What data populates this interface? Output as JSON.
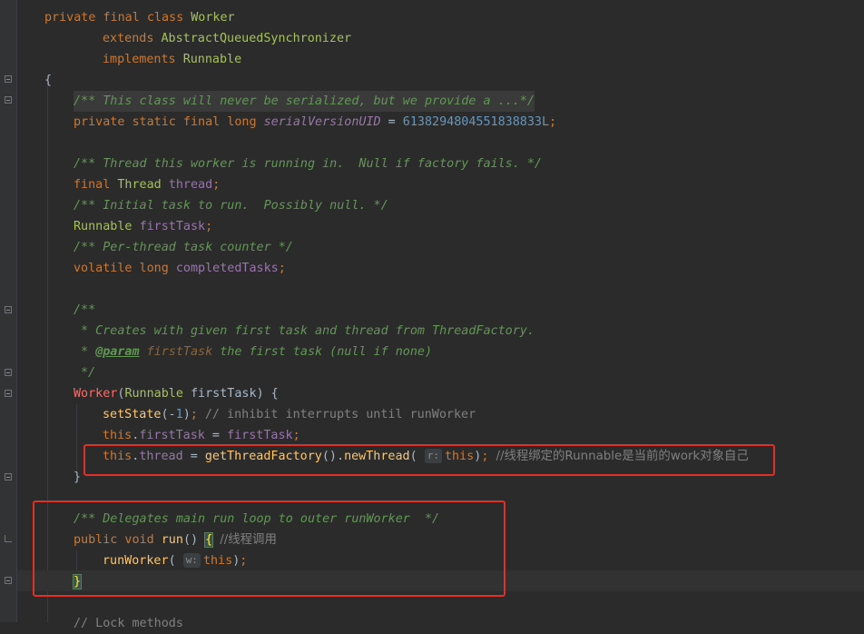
{
  "editor": {
    "language": "Java",
    "lines": [
      {
        "id": "l1",
        "tokens": [
          [
            "kw",
            "private final class "
          ],
          [
            "iface",
            "Worker"
          ]
        ]
      },
      {
        "id": "l2",
        "tokens": [
          [
            "kw",
            "extends "
          ],
          [
            "iface",
            "AbstractQueuedSynchronizer"
          ]
        ]
      },
      {
        "id": "l3",
        "tokens": [
          [
            "kw",
            "implements "
          ],
          [
            "iface",
            "Runnable"
          ]
        ]
      },
      {
        "id": "l4",
        "tokens": [
          [
            "cls",
            "{"
          ]
        ]
      },
      {
        "id": "l5",
        "tokens": [
          [
            "doc",
            "/** This class will never be serialized, but we provide a ...*/"
          ]
        ]
      },
      {
        "id": "l6",
        "tokens": [
          [
            "kw",
            "private static final long "
          ],
          [
            "sfld",
            "serialVersionUID"
          ],
          [
            "cls",
            " = "
          ],
          [
            "num",
            "6138294804551838833L"
          ],
          [
            "kw",
            ";"
          ]
        ]
      },
      {
        "id": "l7",
        "tokens": []
      },
      {
        "id": "l8",
        "tokens": [
          [
            "doc",
            "/** Thread this worker is running in.  Null if factory fails. */"
          ]
        ]
      },
      {
        "id": "l9",
        "tokens": [
          [
            "kw",
            "final "
          ],
          [
            "iface",
            "Thread "
          ],
          [
            "fld",
            "thread"
          ],
          [
            "kw",
            ";"
          ]
        ]
      },
      {
        "id": "l10",
        "tokens": [
          [
            "doc",
            "/** Initial task to run.  Possibly null. */"
          ]
        ]
      },
      {
        "id": "l11",
        "tokens": [
          [
            "iface",
            "Runnable "
          ],
          [
            "fld",
            "firstTask"
          ],
          [
            "kw",
            ";"
          ]
        ]
      },
      {
        "id": "l12",
        "tokens": [
          [
            "doc",
            "/** Per-thread task counter */"
          ]
        ]
      },
      {
        "id": "l13",
        "tokens": [
          [
            "kw",
            "volatile long "
          ],
          [
            "fld",
            "completedTasks"
          ],
          [
            "kw",
            ";"
          ]
        ]
      },
      {
        "id": "l14",
        "tokens": []
      },
      {
        "id": "l15",
        "tokens": [
          [
            "doc",
            "/**"
          ]
        ]
      },
      {
        "id": "l16",
        "tokens": [
          [
            "doc",
            " * Creates with given first task and thread from ThreadFactory."
          ]
        ]
      },
      {
        "id": "l17",
        "tokens": [
          [
            "doc",
            " * "
          ],
          [
            "tag",
            "@param"
          ],
          [
            "doc",
            " "
          ],
          [
            "tagval",
            "firstTask"
          ],
          [
            "doc",
            " the first task (null if none)"
          ]
        ]
      },
      {
        "id": "l18",
        "tokens": [
          [
            "doc",
            " */"
          ]
        ]
      },
      {
        "id": "l19",
        "tokens": [
          [
            "ctor",
            "Worker"
          ],
          [
            "cls",
            "("
          ],
          [
            "iface",
            "Runnable "
          ],
          [
            "param",
            "firstTask"
          ],
          [
            "cls",
            ") {"
          ]
        ]
      },
      {
        "id": "l20",
        "tokens": [
          [
            "fn",
            "setState"
          ],
          [
            "cls",
            "(-"
          ],
          [
            "num",
            "1"
          ],
          [
            "cls",
            ")"
          ],
          [
            "kw",
            "; "
          ],
          [
            "cmt",
            "// inhibit interrupts until runWorker"
          ]
        ]
      },
      {
        "id": "l21",
        "tokens": [
          [
            "kw",
            "this"
          ],
          [
            "cls",
            "."
          ],
          [
            "fld",
            "firstTask"
          ],
          [
            "cls",
            " = "
          ],
          [
            "fld",
            "firstTask"
          ],
          [
            "kw",
            ";"
          ]
        ]
      },
      {
        "id": "l22",
        "tokens": [
          [
            "kw",
            "this"
          ],
          [
            "cls",
            "."
          ],
          [
            "fld",
            "thread"
          ],
          [
            "cls",
            " = "
          ],
          [
            "fn",
            "getThreadFactory"
          ],
          [
            "cls",
            "()."
          ],
          [
            "fn",
            "newThread"
          ],
          [
            "cls",
            "( "
          ],
          [
            "hint",
            "r:"
          ],
          [
            "kw",
            "this"
          ],
          [
            "cls",
            ")"
          ],
          [
            "kw",
            "; "
          ],
          [
            "cmt",
            "//线程绑定的Runnable是当前的work对象自己"
          ]
        ]
      },
      {
        "id": "l23",
        "tokens": [
          [
            "cls",
            "}"
          ]
        ]
      },
      {
        "id": "l24",
        "tokens": []
      },
      {
        "id": "l25",
        "tokens": [
          [
            "doc",
            "/** Delegates main run loop to outer runWorker  */"
          ]
        ]
      },
      {
        "id": "l26",
        "tokens": [
          [
            "kw",
            "public void "
          ],
          [
            "fn",
            "run"
          ],
          [
            "cls",
            "() "
          ],
          [
            "brace",
            "{"
          ],
          [
            "cls",
            " "
          ],
          [
            "cmt",
            "//线程调用"
          ]
        ]
      },
      {
        "id": "l27",
        "tokens": [
          [
            "fn",
            "runWorker"
          ],
          [
            "cls",
            "( "
          ],
          [
            "hint",
            "w:"
          ],
          [
            "kw",
            "this"
          ],
          [
            "cls",
            ")"
          ],
          [
            "kw",
            ";"
          ]
        ]
      },
      {
        "id": "l28",
        "tokens": [
          [
            "brace",
            "}"
          ]
        ]
      },
      {
        "id": "l29",
        "tokens": []
      },
      {
        "id": "l30",
        "tokens": [
          [
            "cmt",
            "// Lock methods"
          ]
        ]
      }
    ]
  }
}
